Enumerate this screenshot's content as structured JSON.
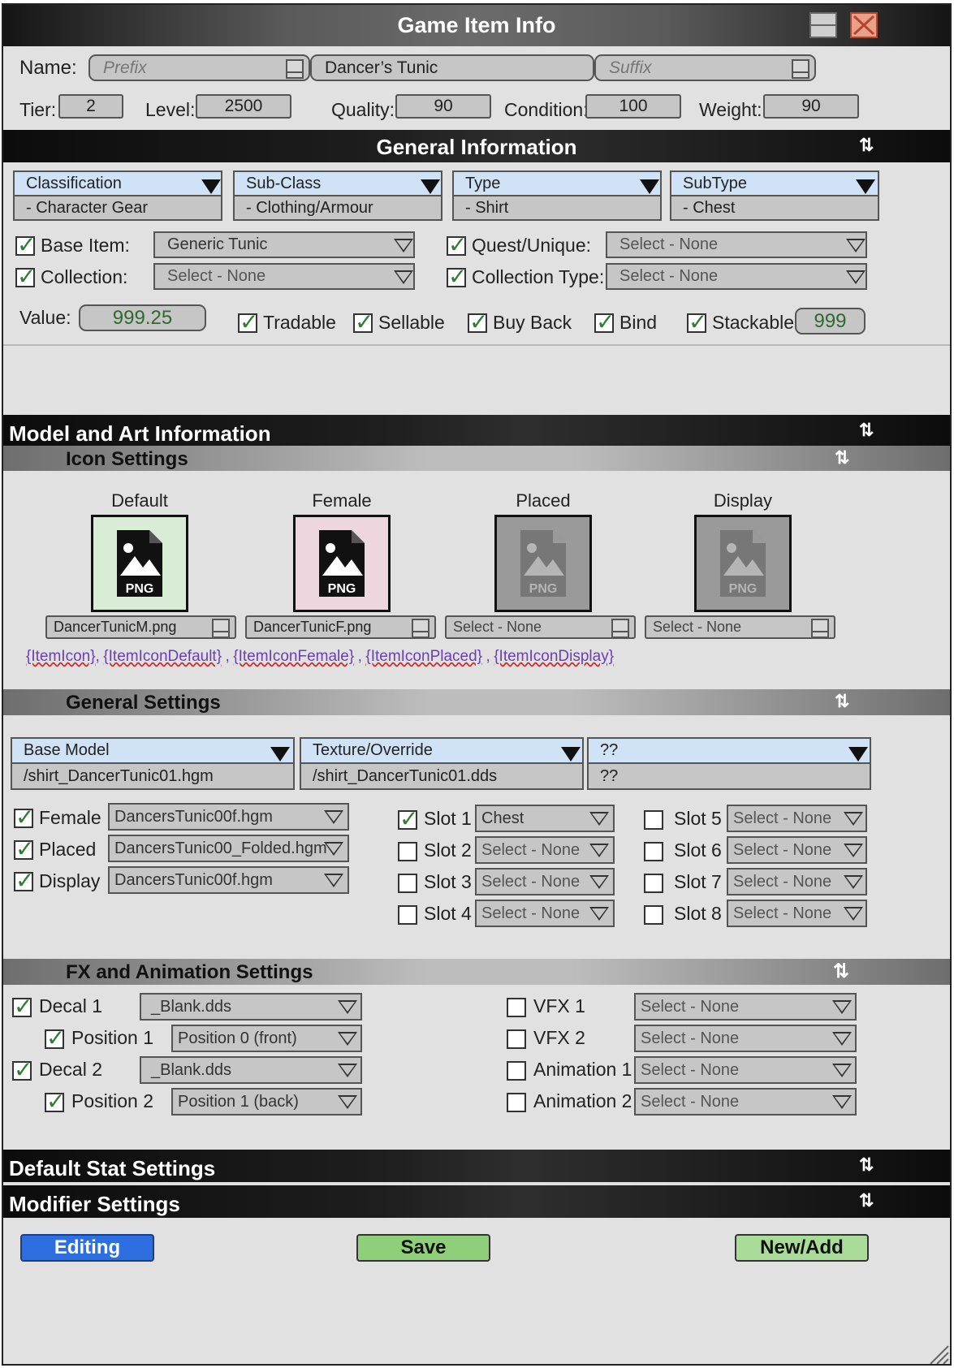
{
  "window": {
    "title": "Game Item Info"
  },
  "name_row": {
    "label": "Name:",
    "prefix_placeholder": "Prefix",
    "name_value": "Dancer’s Tunic",
    "suffix_placeholder": "Suffix"
  },
  "stats_row": [
    {
      "label": "Tier:",
      "value": "2"
    },
    {
      "label": "Level:",
      "value": "2500"
    },
    {
      "label": "Quality:",
      "value": "90"
    },
    {
      "label": "Condition:",
      "value": "100"
    },
    {
      "label": "Weight:",
      "value": "90"
    }
  ],
  "general_info": {
    "header": "General Information",
    "dropdowns": [
      {
        "label": "Classification",
        "value": "- Character Gear"
      },
      {
        "label": "Sub-Class",
        "value": "- Clothing/Armour"
      },
      {
        "label": "Type",
        "value": "- Shirt"
      },
      {
        "label": "SubType",
        "value": "- Chest"
      }
    ],
    "base_item": {
      "label": "Base Item:",
      "value": "Generic Tunic",
      "checked": true
    },
    "collection": {
      "label": "Collection:",
      "value": "Select - None",
      "checked": true
    },
    "quest_unique": {
      "label": "Quest/Unique:",
      "value": "Select - None",
      "checked": true
    },
    "collection_type": {
      "label": "Collection Type:",
      "value": "Select - None",
      "checked": true
    },
    "value": {
      "label": "Value:",
      "value": "999.25"
    },
    "flags": [
      {
        "label": "Tradable",
        "checked": true
      },
      {
        "label": "Sellable",
        "checked": true
      },
      {
        "label": "Buy Back",
        "checked": true
      },
      {
        "label": "Bind",
        "checked": true
      },
      {
        "label": "Stackable:",
        "checked": true
      }
    ],
    "stackable_value": "999"
  },
  "model_art": {
    "header": "Model and Art Information",
    "icon_settings": {
      "header": "Icon Settings",
      "icons": [
        {
          "label": "Default",
          "file": "DancerTunicM.png",
          "bg": "#d8ecd6",
          "active": true
        },
        {
          "label": "Female",
          "file": "DancerTunicF.png",
          "bg": "#eed6df",
          "active": true
        },
        {
          "label": "Placed",
          "file": "Select - None",
          "bg": "#9a9a9a",
          "active": false
        },
        {
          "label": "Display",
          "file": "Select - None",
          "bg": "#9a9a9a",
          "active": false
        }
      ],
      "png_label": "PNG",
      "variables": [
        "{ItemIcon},",
        "{ItemIconDefault}",
        ",",
        "{ItemIconFemale}",
        ",",
        "{ItemIconPlaced}",
        ",",
        "{ItemIconDisplay}"
      ]
    },
    "general_settings": {
      "header": "General Settings",
      "dropdowns": [
        {
          "label": "Base Model",
          "value": "/shirt_DancerTunic01.hgm"
        },
        {
          "label": "Texture/Override",
          "value": "/shirt_DancerTunic01.dds"
        },
        {
          "label": "??",
          "value": "??"
        }
      ],
      "variants": [
        {
          "label": "Female",
          "value": "DancersTunic00f.hgm",
          "checked": true
        },
        {
          "label": "Placed",
          "value": "DancersTunic00_Folded.hgm",
          "checked": true
        },
        {
          "label": "Display",
          "value": "DancersTunic00f.hgm",
          "checked": true
        }
      ],
      "slots": [
        {
          "label": "Slot 1",
          "value": "Chest",
          "checked": true
        },
        {
          "label": "Slot 2",
          "value": "Select - None",
          "checked": false
        },
        {
          "label": "Slot 3",
          "value": "Select - None",
          "checked": false
        },
        {
          "label": "Slot 4",
          "value": "Select - None",
          "checked": false
        },
        {
          "label": "Slot 5",
          "value": "Select - None",
          "checked": false
        },
        {
          "label": "Slot 6",
          "value": "Select - None",
          "checked": false
        },
        {
          "label": "Slot 7",
          "value": "Select - None",
          "checked": false
        },
        {
          "label": "Slot 8",
          "value": "Select - None",
          "checked": false
        }
      ]
    },
    "fx_settings": {
      "header": "FX and Animation Settings",
      "decals": [
        {
          "label": "Decal 1",
          "value": "_Blank.dds",
          "checked": true,
          "indent": false
        },
        {
          "label": "Position 1",
          "value": "Position 0 (front)",
          "checked": true,
          "indent": true
        },
        {
          "label": "Decal 2",
          "value": "_Blank.dds",
          "checked": true,
          "indent": false
        },
        {
          "label": "Position 2",
          "value": "Position 1 (back)",
          "checked": true,
          "indent": true
        }
      ],
      "effects": [
        {
          "label": "VFX 1",
          "value": "Select - None",
          "checked": false
        },
        {
          "label": "VFX 2",
          "value": "Select - None",
          "checked": false
        },
        {
          "label": "Animation 1",
          "value": "Select - None",
          "checked": false
        },
        {
          "label": "Animation 2",
          "value": "Select - None",
          "checked": false
        }
      ]
    }
  },
  "default_stat_settings": {
    "header": "Default Stat Settings"
  },
  "modifier_settings": {
    "header": "Modifier Settings"
  },
  "footer": {
    "editing_label": "Editing",
    "save_label": "Save",
    "new_add_label": "New/Add"
  },
  "colors": {
    "editing_button": "#2d6fe0",
    "save_button": "#8fcf7a",
    "new_add_button": "#a8dc98",
    "link_text": "#6a3fb5",
    "check_green": "#2e7d32"
  }
}
